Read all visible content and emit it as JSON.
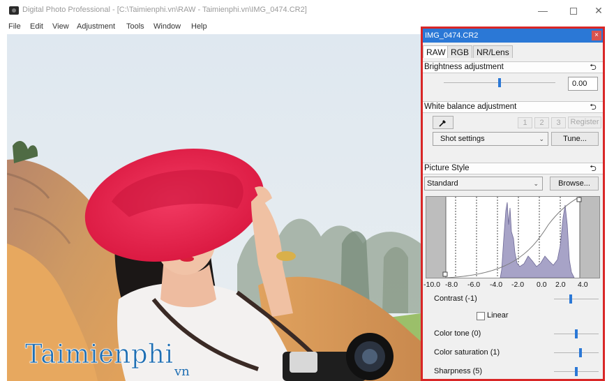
{
  "window": {
    "title": "Digital Photo Professional - [C:\\Taimienphi.vn\\RAW - Taimienphi.vn\\IMG_0474.CR2]",
    "minimize_glyph": "—",
    "close_glyph": "✕"
  },
  "menu": [
    "File",
    "Edit",
    "View",
    "Adjustment",
    "Tools",
    "Window",
    "Help"
  ],
  "watermark": {
    "main": "Taimienphi",
    "suffix": "vn"
  },
  "palette": {
    "title": "IMG_0474.CR2",
    "close_glyph": "×",
    "tabs": [
      "RAW",
      "RGB",
      "NR/Lens"
    ],
    "active_tab": "RAW",
    "undo_glyph": "⮌",
    "brightness": {
      "header": "Brightness adjustment",
      "value": "0.00",
      "level": 0.5
    },
    "white_balance": {
      "header": "White balance adjustment",
      "eyedropper_icon": "eyedropper-icon",
      "presets": [
        "1",
        "2",
        "3"
      ],
      "register": "Register",
      "mode": "Shot settings",
      "tune": "Tune..."
    },
    "picture_style": {
      "header": "Picture Style",
      "style": "Standard",
      "browse": "Browse...",
      "histogram_ticks": [
        "-10.0",
        "-8.0",
        "-6.0",
        "-4.0",
        "-2.0",
        "0.0",
        "2.0",
        "4.0"
      ],
      "params": [
        {
          "label": "Contrast (-1)",
          "level": 0.38
        },
        {
          "label": "Color tone (0)",
          "level": 0.5
        },
        {
          "label": "Color saturation (1)",
          "level": 0.6
        },
        {
          "label": "Sharpness (5)",
          "level": 0.5
        }
      ],
      "linear_label": "Linear"
    }
  },
  "colors": {
    "palette_highlight": "#d92626",
    "title_bar": "#2b78d6",
    "hat": "#e21d4c",
    "watermark": "#1f6fb3"
  }
}
